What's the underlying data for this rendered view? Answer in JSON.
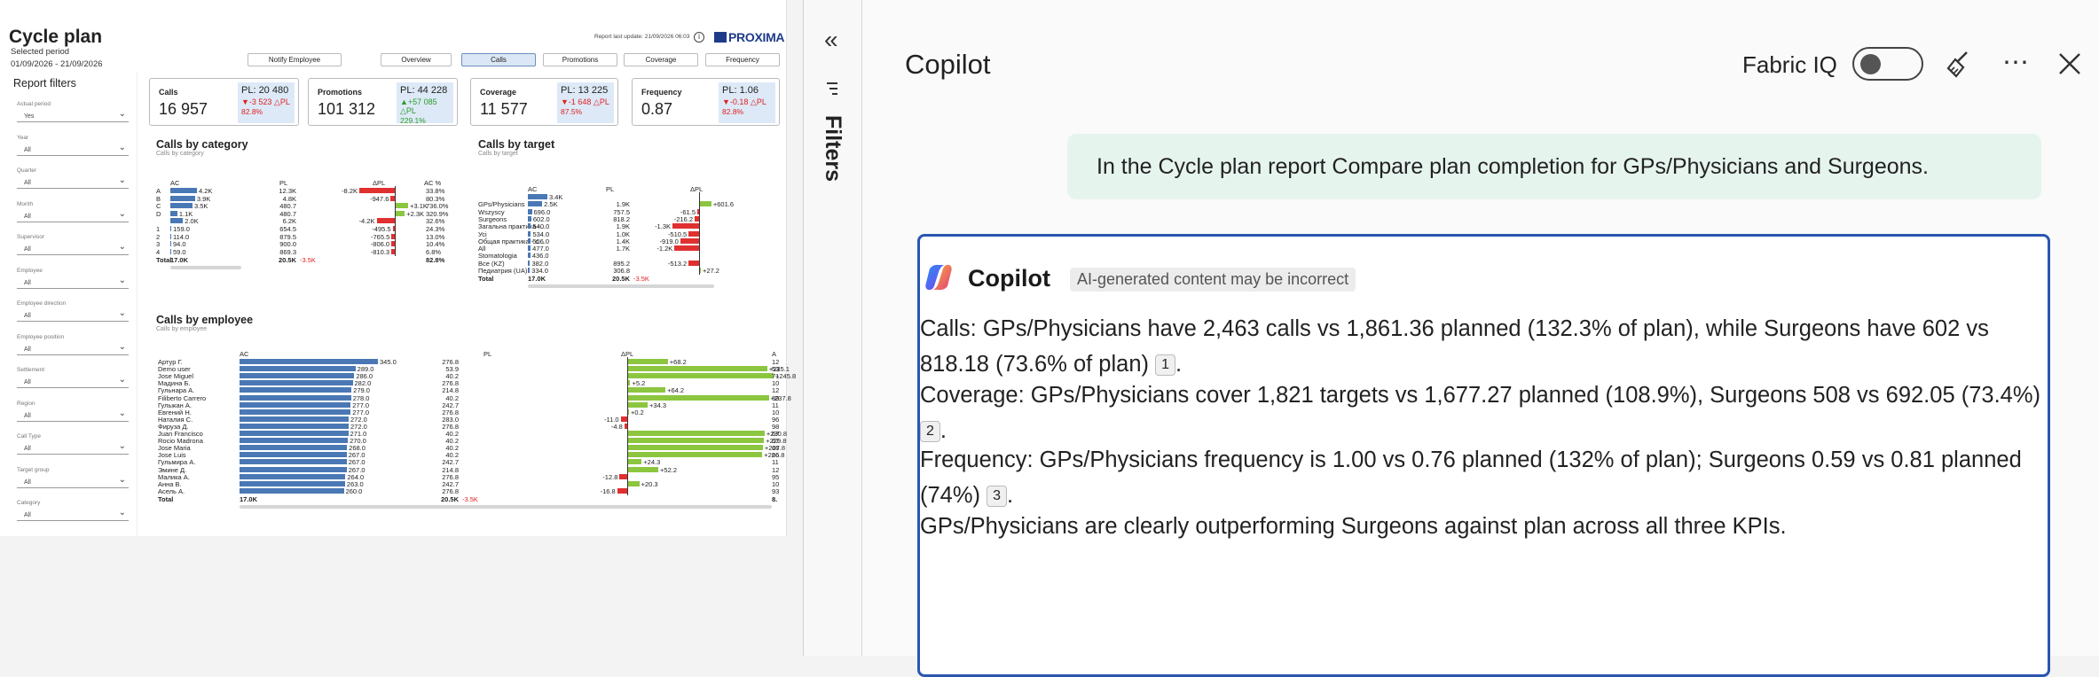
{
  "report": {
    "title": "Cycle plan",
    "selected_period_label": "Selected period",
    "period_value": "01/09/2026 - 21/09/2026",
    "last_update": "Report last update: 21/09/2026 06:03",
    "logo": "PROXIMA",
    "nav": [
      "Notify Employee",
      "Overview",
      "Calls",
      "Promotions",
      "Coverage",
      "Frequency"
    ],
    "filters": {
      "title": "Report filters",
      "items": [
        {
          "label": "Actual period",
          "value": "Yes"
        },
        {
          "label": "Year",
          "value": "All"
        },
        {
          "label": "Quarter",
          "value": "All"
        },
        {
          "label": "Month",
          "value": "All"
        },
        {
          "label": "Supervisor",
          "value": "All"
        },
        {
          "label": "Employee",
          "value": "All"
        },
        {
          "label": "Employee direction",
          "value": "All"
        },
        {
          "label": "Employee position",
          "value": "All"
        },
        {
          "label": "Settlement",
          "value": "All"
        },
        {
          "label": "Region",
          "value": "All"
        },
        {
          "label": "Call Type",
          "value": "All"
        },
        {
          "label": "Target group",
          "value": "All"
        },
        {
          "label": "Category",
          "value": "All"
        }
      ]
    },
    "kpis": [
      {
        "name": "Calls",
        "value": "16 957",
        "pl": "PL: 20 480",
        "delta": "▼-3 523 △PL",
        "pct": "82.8%",
        "dir": "neg"
      },
      {
        "name": "Promotions",
        "value": "101 312",
        "pl": "PL: 44 228",
        "delta": "▲+57 085 △PL",
        "pct": "229.1%",
        "dir": "pos"
      },
      {
        "name": "Coverage",
        "value": "11 577",
        "pl": "PL: 13 225",
        "delta": "▼-1 648 △PL",
        "pct": "87.5%",
        "dir": "neg"
      },
      {
        "name": "Frequency",
        "value": "0.87",
        "pl": "PL: 1.06",
        "delta": "▼-0.18 △PL",
        "pct": "82.8%",
        "dir": "neg"
      }
    ],
    "cat": {
      "title": "Calls by category",
      "subtitle": "Calls by category",
      "cols": [
        "AC",
        "PL",
        "ΔPL",
        "AC %"
      ],
      "rows": [
        {
          "l": "A",
          "ac": 4.2,
          "acl": "4.2K",
          "pl": "12.3K",
          "d": -8.2,
          "dl": "-8.2K",
          "p": "33.8%"
        },
        {
          "l": "B",
          "ac": 3.9,
          "acl": "3.9K",
          "pl": "4.8K",
          "d": -0.948,
          "dl": "-947.6",
          "p": "80.3%"
        },
        {
          "l": "C",
          "ac": 3.5,
          "acl": "3.5K",
          "pl": "480.7",
          "d": 3.1,
          "dl": "+3.1K",
          "p": "736.0%"
        },
        {
          "l": "D",
          "ac": 1.1,
          "acl": "1.1K",
          "pl": "480.7",
          "d": 2.3,
          "dl": "+2.3K",
          "p": "320.9%"
        },
        {
          "l": "",
          "ac": 2.0,
          "acl": "2.0K",
          "pl": "6.2K",
          "d": -4.2,
          "dl": "-4.2K",
          "p": "32.6%"
        },
        {
          "l": "1",
          "ac": 0.159,
          "acl": "159.0",
          "pl": "654.5",
          "d": -0.4955,
          "dl": "-495.5",
          "p": "24.3%"
        },
        {
          "l": "2",
          "ac": 0.114,
          "acl": "114.0",
          "pl": "879.5",
          "d": -0.7655,
          "dl": "-765.5",
          "p": "13.0%"
        },
        {
          "l": "3",
          "ac": 0.094,
          "acl": "94.0",
          "pl": "900.0",
          "d": -0.806,
          "dl": "-806.0",
          "p": "10.4%"
        },
        {
          "l": "4",
          "ac": 0.059,
          "acl": "59.0",
          "pl": "869.3",
          "d": -0.8103,
          "dl": "-810.3",
          "p": "6.8%"
        }
      ],
      "total": {
        "l": "Total",
        "ac": "17.0K",
        "pl": "20.5K",
        "d": "-3.5K",
        "p": "82.8%"
      }
    },
    "tgt": {
      "title": "Calls by target",
      "subtitle": "Calls by target",
      "cols": [
        "AC",
        "PL",
        "ΔPL"
      ],
      "rows": [
        {
          "l": "",
          "ac": 3.4,
          "acl": "3.4K",
          "pl": "",
          "d": 0,
          "dl": ""
        },
        {
          "l": "GPs/Physicians",
          "ac": 2.5,
          "acl": "2.5K",
          "pl": "1.9K",
          "d": 0.6016,
          "dl": "+601.6"
        },
        {
          "l": "Wszyscy",
          "ac": 0.696,
          "acl": "696.0",
          "pl": "757.5",
          "d": -0.0615,
          "dl": "-61.5"
        },
        {
          "l": "Surgeons",
          "ac": 0.602,
          "acl": "602.0",
          "pl": "818.2",
          "d": -0.2162,
          "dl": "-216.2"
        },
        {
          "l": "Загальна практика -...",
          "ac": 0.54,
          "acl": "540.0",
          "pl": "1.9K",
          "d": -1.3,
          "dl": "-1.3K"
        },
        {
          "l": "Усі",
          "ac": 0.534,
          "acl": "534.0",
          "pl": "1.0K",
          "d": -0.5105,
          "dl": "-510.5"
        },
        {
          "l": "Общая практика - с...",
          "ac": 0.506,
          "acl": "506.0",
          "pl": "1.4K",
          "d": -0.919,
          "dl": "-919.0"
        },
        {
          "l": "All",
          "ac": 0.477,
          "acl": "477.0",
          "pl": "1.7K",
          "d": -1.2,
          "dl": "-1.2K"
        },
        {
          "l": "Stomatologia",
          "ac": 0.436,
          "acl": "436.0",
          "pl": "",
          "d": 0,
          "dl": ""
        },
        {
          "l": "Все (KZ)",
          "ac": 0.382,
          "acl": "382.0",
          "pl": "895.2",
          "d": -0.5132,
          "dl": "-513.2"
        },
        {
          "l": "Педиатрия (UA)",
          "ac": 0.334,
          "acl": "334.0",
          "pl": "306.8",
          "d": 0.0272,
          "dl": "+27.2"
        }
      ],
      "total": {
        "l": "Total",
        "ac": "17.0K",
        "pl": "20.5K",
        "d": "-3.5K"
      }
    },
    "emp": {
      "title": "Calls by employee",
      "subtitle": "Calls by employee",
      "cols": [
        "AC",
        "PL",
        "ΔPL",
        "A"
      ],
      "rows": [
        {
          "l": "Артур Г.",
          "ac": 345,
          "acl": "345.0",
          "pl": "276.8",
          "d": 68.2,
          "dl": "+68.2",
          "p": "12"
        },
        {
          "l": "Demo user",
          "ac": 289,
          "acl": "289.0",
          "pl": "53.9",
          "d": 235.1,
          "dl": "+235.1",
          "p": "53"
        },
        {
          "l": "Jose Miguel",
          "ac": 286,
          "acl": "286.0",
          "pl": "40.2",
          "d": 245.8,
          "dl": "+245.8",
          "p": "71"
        },
        {
          "l": "Мадина Б.",
          "ac": 282,
          "acl": "282.0",
          "pl": "276.8",
          "d": 5.2,
          "dl": "+5.2",
          "p": "10"
        },
        {
          "l": "Гульнара А.",
          "ac": 279,
          "acl": "279.0",
          "pl": "214.8",
          "d": 64.2,
          "dl": "+64.2",
          "p": "12"
        },
        {
          "l": "Filiberto Carrero",
          "ac": 278,
          "acl": "278.0",
          "pl": "40.2",
          "d": 237.8,
          "dl": "+237.8",
          "p": "69"
        },
        {
          "l": "Гульжан А.",
          "ac": 277,
          "acl": "277.0",
          "pl": "242.7",
          "d": 34.3,
          "dl": "+34.3",
          "p": "11"
        },
        {
          "l": "Евгений Н.",
          "ac": 277,
          "acl": "277.0",
          "pl": "276.8",
          "d": 0.2,
          "dl": "+0.2",
          "p": "10"
        },
        {
          "l": "Наталия С.",
          "ac": 272,
          "acl": "272.0",
          "pl": "283.0",
          "d": -11.0,
          "dl": "-11.0",
          "p": "96"
        },
        {
          "l": "Фируза Д.",
          "ac": 272,
          "acl": "272.0",
          "pl": "276.8",
          "d": -4.8,
          "dl": "-4.8",
          "p": "98"
        },
        {
          "l": "Juan Francisco",
          "ac": 271,
          "acl": "271.0",
          "pl": "40.2",
          "d": 230.8,
          "dl": "+230.8",
          "p": "67"
        },
        {
          "l": "Rocio Madrona",
          "ac": 270,
          "acl": "270.0",
          "pl": "40.2",
          "d": 229.8,
          "dl": "+229.8",
          "p": "67"
        },
        {
          "l": "Jose Maria",
          "ac": 268,
          "acl": "268.0",
          "pl": "40.2",
          "d": 227.8,
          "dl": "+227.8",
          "p": "66"
        },
        {
          "l": "Jose Luis",
          "ac": 267,
          "acl": "267.0",
          "pl": "40.2",
          "d": 226.8,
          "dl": "+226.8",
          "p": "66"
        },
        {
          "l": "Гульмира А.",
          "ac": 267,
          "acl": "267.0",
          "pl": "242.7",
          "d": 24.3,
          "dl": "+24.3",
          "p": "11"
        },
        {
          "l": "Эмине Д.",
          "ac": 267,
          "acl": "267.0",
          "pl": "214.8",
          "d": 52.2,
          "dl": "+52.2",
          "p": "12"
        },
        {
          "l": "Малика А.",
          "ac": 264,
          "acl": "264.0",
          "pl": "276.8",
          "d": -12.8,
          "dl": "-12.8",
          "p": "95"
        },
        {
          "l": "Анна В.",
          "ac": 263,
          "acl": "263.0",
          "pl": "242.7",
          "d": 20.3,
          "dl": "+20.3",
          "p": "10"
        },
        {
          "l": "Асель А.",
          "ac": 260,
          "acl": "260.0",
          "pl": "276.8",
          "d": -16.8,
          "dl": "-16.8",
          "p": "93"
        }
      ],
      "total": {
        "l": "Total",
        "ac": "17.0K",
        "pl": "20.5K",
        "d": "-3.5K",
        "p": "8."
      }
    }
  },
  "filters_rail": {
    "label": "Filters",
    "collapse_icon": "double-chevron-left-icon"
  },
  "copilot": {
    "title": "Copilot",
    "fabric_label": "Fabric IQ",
    "toggle_on": false,
    "user_message": "In the Cycle plan report Compare plan completion for GPs/Physicians and Surgeons.",
    "assistant_name": "Copilot",
    "disclaimer": "AI-generated content may be incorrect",
    "paragraphs": [
      {
        "text": "Calls: GPs/Physicians have 2,463 calls vs 1,861.36 planned (132.3% of plan), while Surgeons have 602 vs 818.18 (73.6% of plan)",
        "cite": "1",
        "end": "."
      },
      {
        "text": "Coverage: GPs/Physicians cover 1,821 targets vs 1,677.27 planned (108.9%), Surgeons 508 vs 692.05 (73.4%)",
        "cite": "2",
        "end": "."
      },
      {
        "text": "Frequency: GPs/Physicians frequency is 1.00 vs 0.76 planned (132% of plan); Surgeons 0.59 vs 0.81 planned (74%)",
        "cite": "3",
        "end": "."
      },
      {
        "text": "GPs/Physicians are clearly outperforming Surgeons against plan across all three KPIs.",
        "cite": "",
        "end": ""
      }
    ]
  }
}
